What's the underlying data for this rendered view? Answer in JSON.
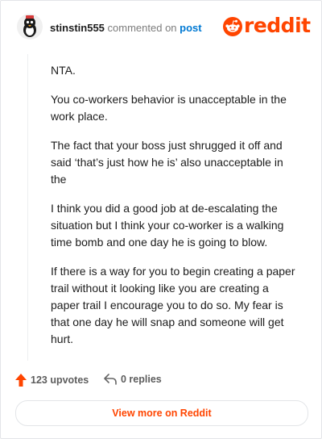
{
  "header": {
    "username": "stinstin555",
    "action_text": "commented on",
    "post_link": "post",
    "logo_text": "reddit"
  },
  "comment": {
    "paragraphs": [
      "NTA.",
      "You co-workers behavior is unacceptable in the work place.",
      "The fact that your boss just shrugged it off and said ‘that’s just how he is’ also unacceptable in the",
      "I think you did a good job at de-escalating the situation but I think your co-worker is a walking time bomb and one day he is going to blow.",
      "If there is a way for you to begin creating a paper trail without it looking like you are creating a paper trail I encourage you to do so. My fear is that one day he will snap and someone will get hurt."
    ]
  },
  "actions": {
    "upvotes_label": "123 upvotes",
    "replies_label": "0 replies"
  },
  "footer": {
    "view_more_label": "View more on Reddit"
  },
  "colors": {
    "brand": "#ff4500",
    "link": "#0079d3",
    "border": "#e3e5e8"
  },
  "icons": [
    "avatar",
    "reddit-logo-icon",
    "upvote-arrow-icon",
    "reply-icon"
  ]
}
